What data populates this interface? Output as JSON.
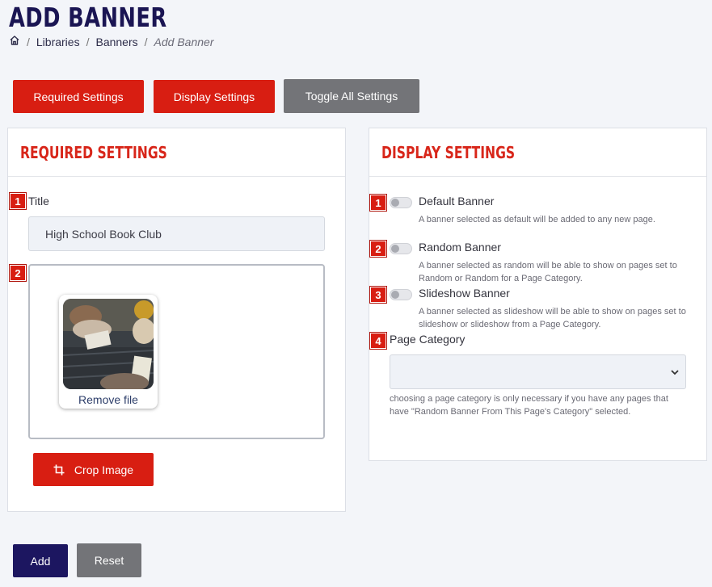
{
  "page": {
    "title": "ADD BANNER"
  },
  "breadcrumb": {
    "home_icon": "home-icon",
    "items": [
      "Libraries",
      "Banners"
    ],
    "current": "Add Banner"
  },
  "tabs": {
    "required": "Required Settings",
    "display": "Display Settings",
    "toggle_all": "Toggle All Settings"
  },
  "required_panel": {
    "title": "REQUIRED SETTINGS",
    "title_field": {
      "badge": "1",
      "label": "Title",
      "value": "High School Book Club"
    },
    "image_field": {
      "badge": "2",
      "remove_label": "Remove file"
    },
    "crop_button": {
      "label": "Crop Image",
      "icon": "crop-icon"
    }
  },
  "display_panel": {
    "title": "DISPLAY SETTINGS",
    "options": [
      {
        "badge": "1",
        "label": "Default Banner",
        "help": "A banner selected as default will be added to any new page."
      },
      {
        "badge": "2",
        "label": "Random Banner",
        "help": "A banner selected as random will be able to show on pages set to Random or Random for a Page Category."
      },
      {
        "badge": "3",
        "label": "Slideshow Banner",
        "help": "A banner selected as slideshow will be able to show on pages set to slideshow or slideshow from a Page Category."
      }
    ],
    "category": {
      "badge": "4",
      "label": "Page Category",
      "selected": "",
      "help": "choosing a page category is only necessary if you have any pages that have \"Random Banner From This Page's Category\" selected."
    }
  },
  "actions": {
    "add": "Add",
    "reset": "Reset"
  },
  "colors": {
    "primary_red": "#d81e12",
    "navy": "#1c1660",
    "gray": "#737478",
    "heading_red": "#d8261a"
  }
}
